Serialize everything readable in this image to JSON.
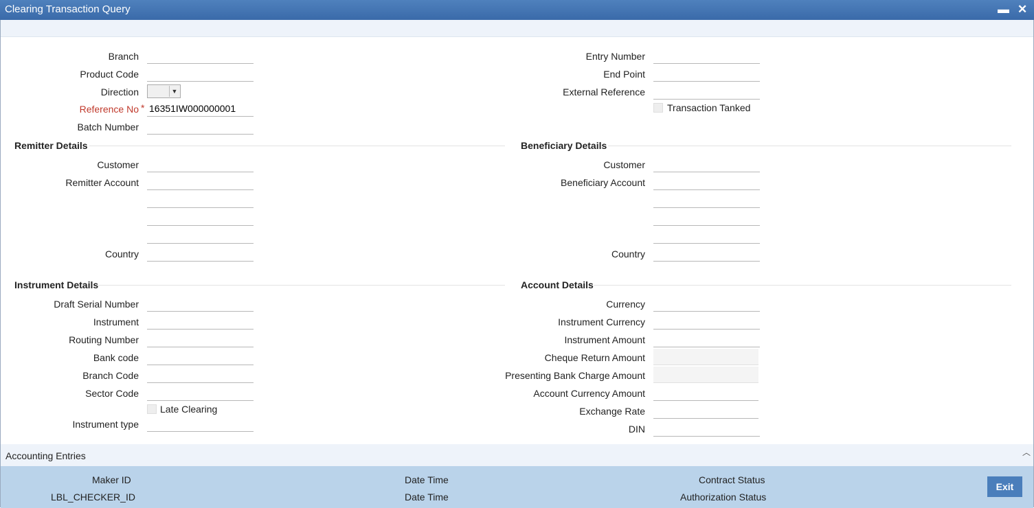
{
  "window": {
    "title": "Clearing Transaction Query",
    "minimize": "▬",
    "close": "✕"
  },
  "header": {
    "branch_label": "Branch",
    "product_code_label": "Product Code",
    "direction_label": "Direction",
    "reference_no_label": "Reference No",
    "required_mark": "*",
    "reference_no_value": "16351IW000000001",
    "batch_number_label": "Batch Number",
    "entry_number_label": "Entry Number",
    "end_point_label": "End Point",
    "external_reference_label": "External Reference",
    "transaction_tanked_label": "Transaction Tanked"
  },
  "remitter": {
    "title": "Remitter Details",
    "customer_label": "Customer",
    "account_label": "Remitter Account",
    "country_label": "Country"
  },
  "beneficiary": {
    "title": "Beneficiary Details",
    "customer_label": "Customer",
    "account_label": "Beneficiary Account",
    "country_label": "Country"
  },
  "instrument": {
    "title": "Instrument Details",
    "draft_serial_label": "Draft Serial Number",
    "instrument_label": "Instrument",
    "routing_label": "Routing Number",
    "bank_code_label": "Bank code",
    "branch_code_label": "Branch Code",
    "sector_code_label": "Sector Code",
    "late_clearing_label": "Late Clearing",
    "instrument_type_label": "Instrument type"
  },
  "account": {
    "title": "Account Details",
    "currency_label": "Currency",
    "instrument_currency_label": "Instrument Currency",
    "instrument_amount_label": "Instrument Amount",
    "cheque_return_label": "Cheque Return Amount",
    "presenting_charge_label": "Presenting Bank Charge Amount",
    "account_currency_amount_label": "Account Currency Amount",
    "exchange_rate_label": "Exchange Rate",
    "din_label": "DIN"
  },
  "accounting": {
    "label": "Accounting Entries",
    "collapse_icon": "︿"
  },
  "footer": {
    "maker_id_label": "Maker ID",
    "checker_id_label": "LBL_CHECKER_ID",
    "date_time_label_1": "Date Time",
    "date_time_label_2": "Date Time",
    "contract_status_label": "Contract Status",
    "authorization_status_label": "Authorization Status",
    "exit_label": "Exit"
  }
}
